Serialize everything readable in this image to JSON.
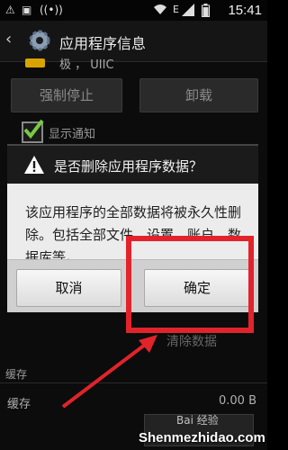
{
  "status_bar": {
    "time": "15:41",
    "network_letter": "E",
    "icons": [
      "warning-icon",
      "image-icon",
      "signal-hotspot-icon",
      "wifi-icon",
      "mobile-signal-icon",
      "battery-icon"
    ]
  },
  "action_bar": {
    "title": "应用程序信息",
    "back_icon": "chevron-left-icon",
    "settings_icon": "gear-icon"
  },
  "app_header": {
    "name_partial": "极 ，  UIIC"
  },
  "background_buttons": {
    "force_stop": "强制停止",
    "uninstall": "卸载"
  },
  "show_notifications": {
    "label": "显示通知",
    "checked": true
  },
  "dialog": {
    "title": "是否删除应用程序数据？",
    "message": "该应用程序的全部数据将被永久性删除。包括全部文件、设置、账户、数据库等。",
    "cancel_label": "取消",
    "ok_label": "确定"
  },
  "clear_data_label": "清除数据",
  "cache_section": {
    "header": "缓存",
    "label": "缓存",
    "value": "0.00 B"
  },
  "watermark": {
    "site": "Shenmezhidao.com",
    "baidu": "Bai 经验"
  },
  "colors": {
    "highlight": "#e2232b",
    "accent_check": "#7ac943",
    "warning_icon": "#ffffff"
  }
}
